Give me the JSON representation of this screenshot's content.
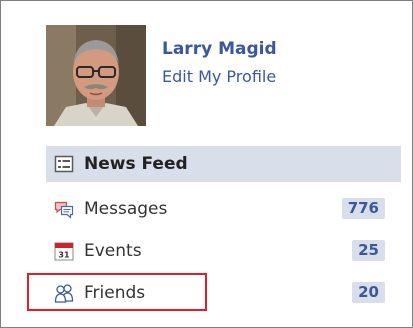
{
  "profile": {
    "name": "Larry Magid",
    "edit_link": "Edit My Profile"
  },
  "nav": {
    "items": [
      {
        "label": "News Feed",
        "icon": "news-feed-icon",
        "selected": true
      },
      {
        "label": "Messages",
        "icon": "messages-icon",
        "count": "776"
      },
      {
        "label": "Events",
        "icon": "calendar-icon",
        "icon_text": "31",
        "count": "25"
      },
      {
        "label": "Friends",
        "icon": "friends-icon",
        "count": "20"
      }
    ]
  },
  "colors": {
    "link": "#3b5998",
    "selected_bg": "#d8dfea",
    "highlight": "#e21d2a"
  }
}
